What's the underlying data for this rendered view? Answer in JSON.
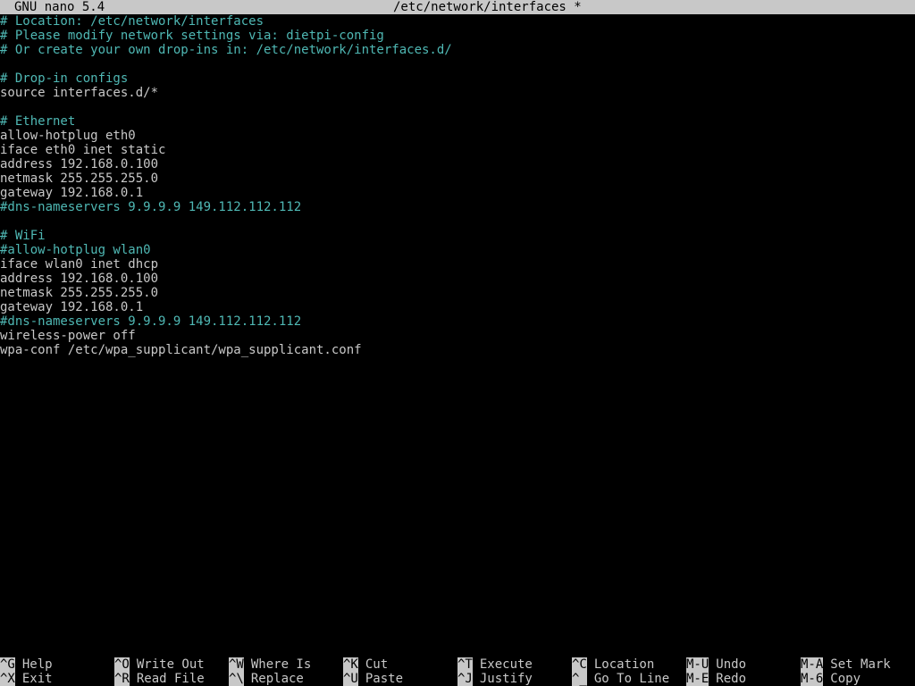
{
  "titlebar": {
    "app": "GNU nano 5.4",
    "file": "/etc/network/interfaces *"
  },
  "editor": {
    "lines": [
      "# Location: /etc/network/interfaces",
      "# Please modify network settings via: dietpi-config",
      "# Or create your own drop-ins in: /etc/network/interfaces.d/",
      "",
      "# Drop-in configs",
      "source interfaces.d/*",
      "",
      "# Ethernet",
      "allow-hotplug eth0",
      "iface eth0 inet static",
      "address 192.168.0.100",
      "netmask 255.255.255.0",
      "gateway 192.168.0.1",
      "#dns-nameservers 9.9.9.9 149.112.112.112",
      "",
      "# WiFi",
      "#allow-hotplug wlan0",
      "iface wlan0 inet dhcp",
      "address 192.168.0.100",
      "netmask 255.255.255.0",
      "gateway 192.168.0.1",
      "#dns-nameservers 9.9.9.9 149.112.112.112",
      "wireless-power off",
      "wpa-conf /etc/wpa_supplicant/wpa_supplicant.conf"
    ]
  },
  "shortcuts": {
    "row1": [
      {
        "key": "^G",
        "label": "Help"
      },
      {
        "key": "^O",
        "label": "Write Out"
      },
      {
        "key": "^W",
        "label": "Where Is"
      },
      {
        "key": "^K",
        "label": "Cut"
      },
      {
        "key": "^T",
        "label": "Execute"
      },
      {
        "key": "^C",
        "label": "Location"
      },
      {
        "key": "M-U",
        "label": "Undo"
      },
      {
        "key": "M-A",
        "label": "Set Mark"
      }
    ],
    "row2": [
      {
        "key": "^X",
        "label": "Exit"
      },
      {
        "key": "^R",
        "label": "Read File"
      },
      {
        "key": "^\\",
        "label": "Replace"
      },
      {
        "key": "^U",
        "label": "Paste"
      },
      {
        "key": "^J",
        "label": "Justify"
      },
      {
        "key": "^_",
        "label": "Go To Line"
      },
      {
        "key": "M-E",
        "label": "Redo"
      },
      {
        "key": "M-6",
        "label": "Copy"
      }
    ]
  },
  "colors": {
    "background": "#000000",
    "text": "#c8c8c8",
    "comment": "#4fb8b4",
    "titlebar_bg": "#c8c8c8"
  }
}
